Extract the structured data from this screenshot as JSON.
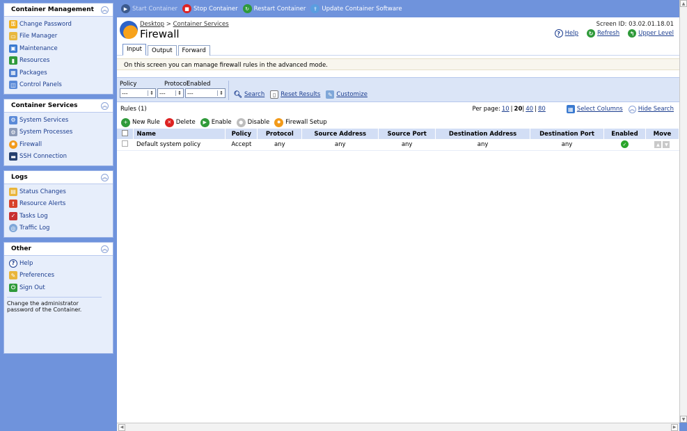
{
  "sidebar": {
    "panels": [
      {
        "title": "Container Management",
        "items": [
          "Change Password",
          "File Manager",
          "Maintenance",
          "Resources",
          "Packages",
          "Control Panels"
        ]
      },
      {
        "title": "Container Services",
        "items": [
          "System Services",
          "System Processes",
          "Firewall",
          "SSH Connection"
        ]
      },
      {
        "title": "Logs",
        "items": [
          "Status Changes",
          "Resource Alerts",
          "Tasks Log",
          "Traffic Log"
        ]
      },
      {
        "title": "Other",
        "items": [
          "Help",
          "Preferences",
          "Sign Out"
        ],
        "hint": "Change the administrator password of the Container."
      }
    ]
  },
  "toolbar": {
    "start": "Start Container",
    "stop": "Stop Container",
    "restart": "Restart Container",
    "update": "Update Container Software"
  },
  "header": {
    "breadcrumb": [
      "Desktop",
      "Container Services"
    ],
    "breadcrumb_sep": ">",
    "title": "Firewall",
    "screen_id": "Screen ID: 03.02.01.18.01",
    "help": "Help",
    "refresh": "Refresh",
    "upper": "Upper Level"
  },
  "tabs": [
    "Input",
    "Output",
    "Forward"
  ],
  "description": "On this screen you can manage firewall rules in the advanced mode.",
  "filter": {
    "labels": [
      "Policy",
      "Protocol",
      "Enabled"
    ],
    "values": [
      "---",
      "---",
      "---"
    ],
    "search": "Search",
    "reset": "Reset Results",
    "customize": "Customize"
  },
  "rules": {
    "count_label": "Rules (1)",
    "per_page_label": "Per page:",
    "per_page_options": [
      "10",
      "20",
      "40",
      "80"
    ],
    "per_page_selected": "20",
    "select_columns": "Select Columns",
    "hide_search": "Hide Search",
    "actions": {
      "new": "New Rule",
      "delete": "Delete",
      "enable": "Enable",
      "disable": "Disable",
      "setup": "Firewall Setup"
    },
    "columns": [
      "Name",
      "Policy",
      "Protocol",
      "Source Address",
      "Source Port",
      "Destination Address",
      "Destination Port",
      "Enabled",
      "Move"
    ],
    "rows": [
      {
        "name": "Default system policy",
        "policy": "Accept",
        "protocol": "any",
        "src_addr": "any",
        "src_port": "any",
        "dst_addr": "any",
        "dst_port": "any",
        "enabled": true
      }
    ]
  }
}
